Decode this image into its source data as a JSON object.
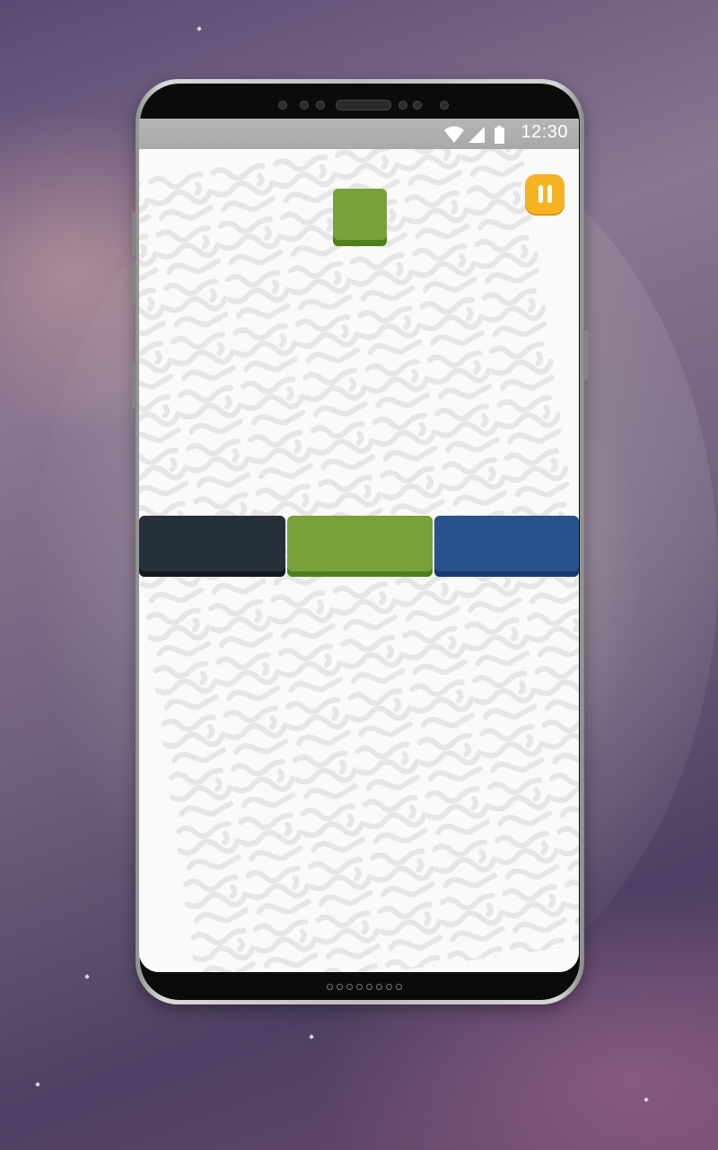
{
  "status_bar": {
    "time": "12:30",
    "icons": [
      "wifi-icon",
      "cell-signal-icon",
      "battery-icon"
    ]
  },
  "game": {
    "pause_icon": "pause-icon",
    "falling_block_color": "#79a03a",
    "color_bars": [
      {
        "name": "dark",
        "color": "#26303a"
      },
      {
        "name": "green",
        "color": "#79a03a"
      },
      {
        "name": "blue",
        "color": "#27528c"
      }
    ],
    "accent_color": "#f5b324",
    "background_color": "#f7f7f7"
  }
}
